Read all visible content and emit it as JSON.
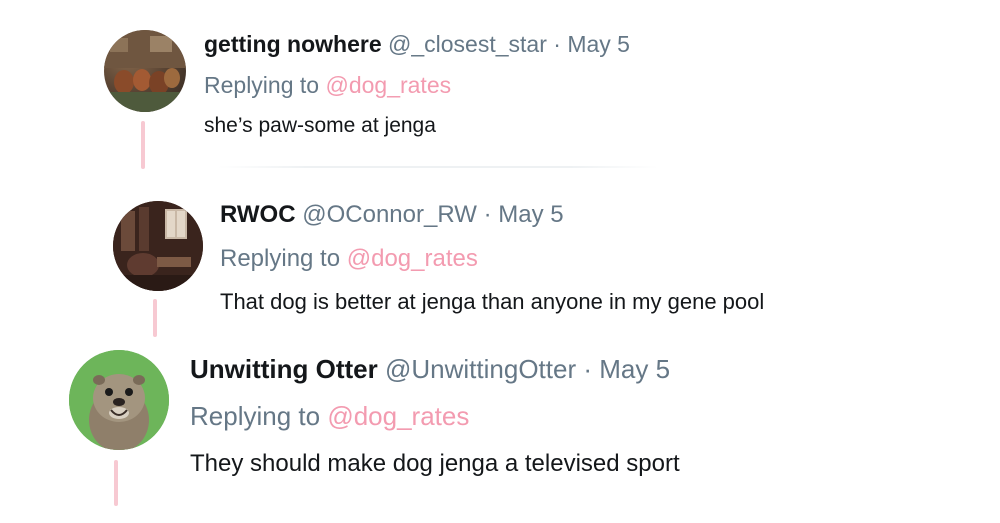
{
  "replies": [
    {
      "name": "getting nowhere",
      "handle": "@_closest_star",
      "sep": "·",
      "date": "May 5",
      "replying_prefix": "Replying to",
      "replying_to": "@dog_rates",
      "text": "she’s paw-some at jenga"
    },
    {
      "name": "RWOC",
      "handle": "@OConnor_RW",
      "sep": "·",
      "date": "May 5",
      "replying_prefix": "Replying to",
      "replying_to": "@dog_rates",
      "text": "That dog is better at jenga than anyone in my gene pool"
    },
    {
      "name": "Unwitting Otter",
      "handle": "@UnwittingOtter",
      "sep": "·",
      "date": "May 5",
      "replying_prefix": "Replying to",
      "replying_to": "@dog_rates",
      "text": "They should make dog jenga a televised sport"
    }
  ],
  "colors": {
    "name": "#14171a",
    "meta": "#657786",
    "mention": "#f39bb0",
    "thread_line": "#f7c9d2"
  }
}
